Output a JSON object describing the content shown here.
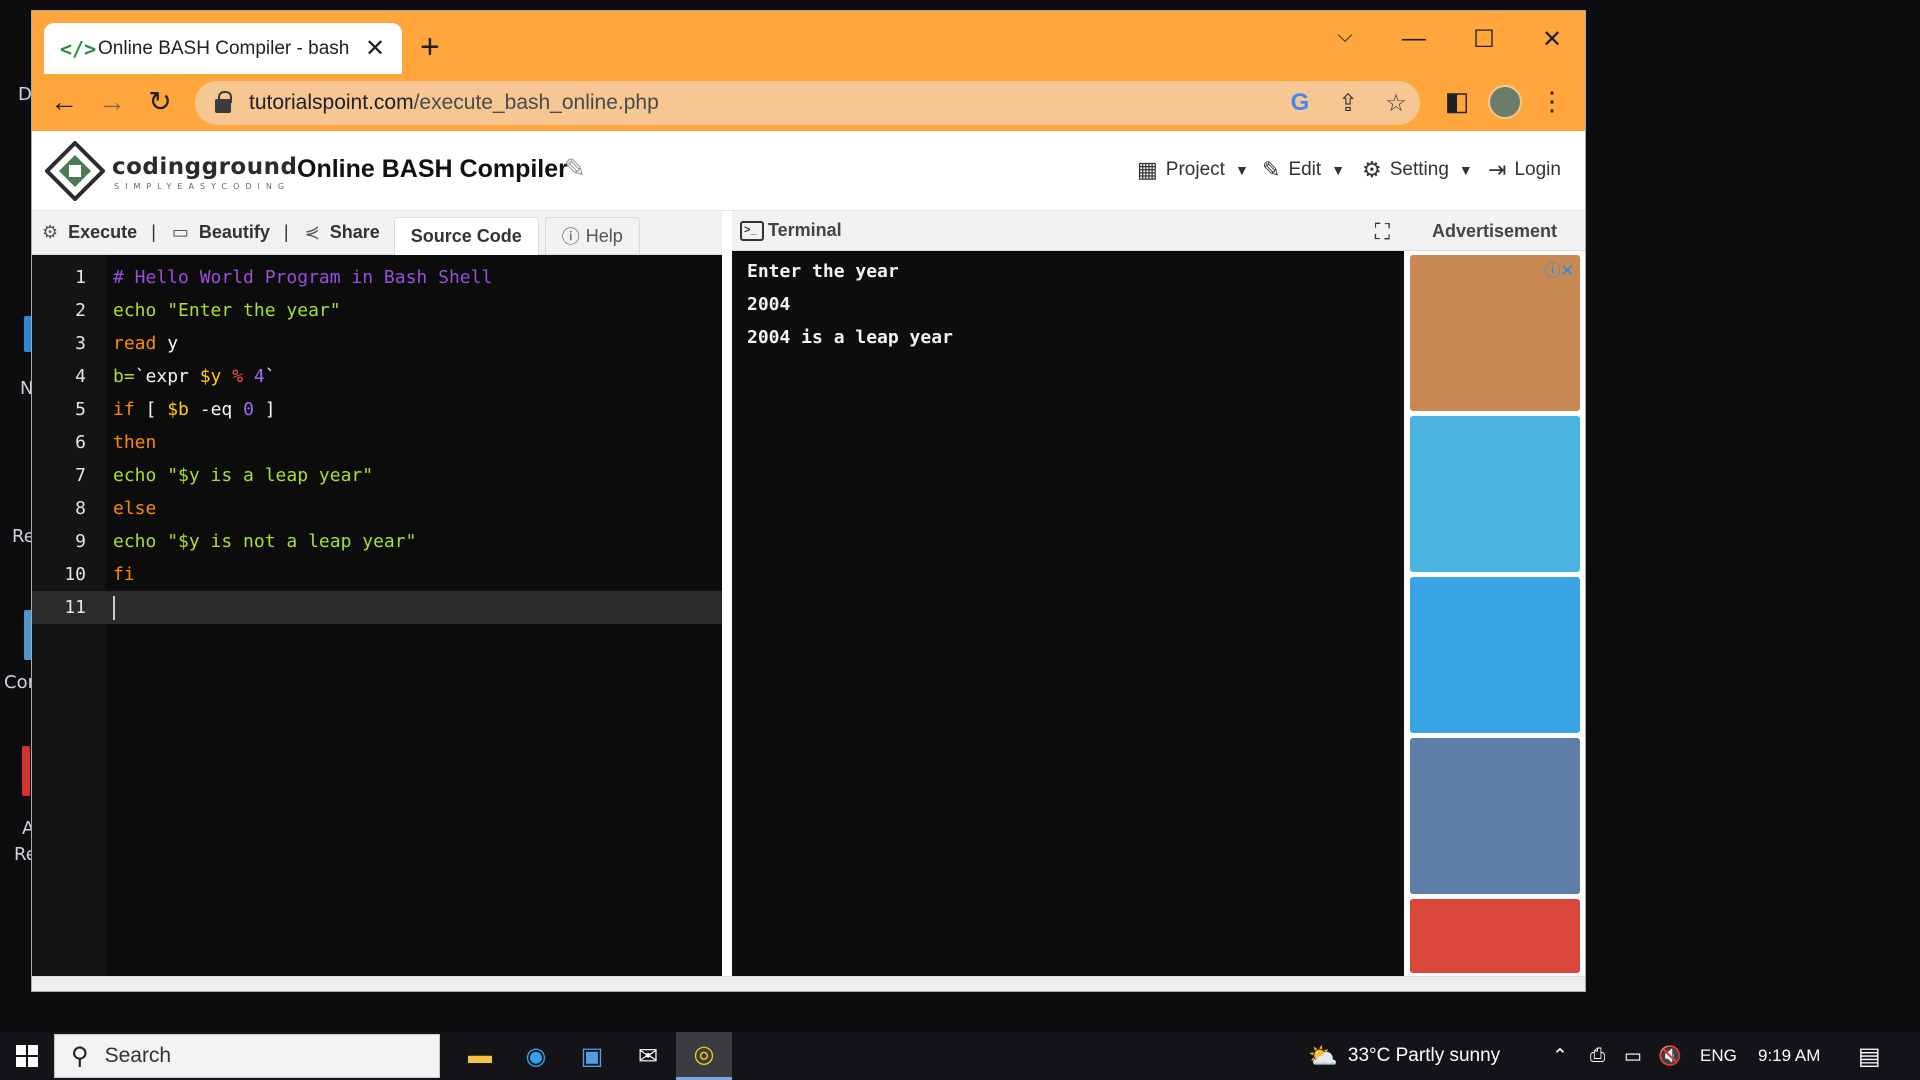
{
  "browser": {
    "tab_title": "Online BASH Compiler - bash",
    "tab_favicon": "</>",
    "url_host": "tutorialspoint.com",
    "url_path": "/execute_bash_online.php"
  },
  "site": {
    "logo_text": "codingground",
    "logo_subtext": "SIMPLYEASYCODING",
    "title": "Online BASH Compiler",
    "menu": {
      "project": "Project",
      "edit": "Edit",
      "setting": "Setting",
      "login": "Login"
    }
  },
  "editor_toolbar": {
    "execute": "Execute",
    "beautify": "Beautify",
    "share": "Share",
    "source_code": "Source Code",
    "help": "Help",
    "separator": "|"
  },
  "code_lines": [
    {
      "num": "1",
      "tokens": [
        {
          "t": "# Hello World Program in Bash Shell",
          "c": "c-comment"
        }
      ]
    },
    {
      "num": "2",
      "tokens": [
        {
          "t": "echo ",
          "c": "c-str"
        },
        {
          "t": "\"Enter the year\"",
          "c": "c-str"
        }
      ]
    },
    {
      "num": "3",
      "tokens": [
        {
          "t": "read",
          "c": "c-kw"
        },
        {
          "t": " y",
          "c": "c-plain"
        }
      ]
    },
    {
      "num": "4",
      "tokens": [
        {
          "t": "b=",
          "c": "c-str"
        },
        {
          "t": "`",
          "c": "c-plain"
        },
        {
          "t": "expr ",
          "c": "c-plain"
        },
        {
          "t": "$y",
          "c": "c-var"
        },
        {
          "t": " % ",
          "c": "c-op"
        },
        {
          "t": "4",
          "c": "c-num"
        },
        {
          "t": "`",
          "c": "c-plain"
        }
      ]
    },
    {
      "num": "5",
      "tokens": [
        {
          "t": "if",
          "c": "c-kw"
        },
        {
          "t": " [ ",
          "c": "c-plain"
        },
        {
          "t": "$b",
          "c": "c-var"
        },
        {
          "t": " -eq ",
          "c": "c-plain"
        },
        {
          "t": "0",
          "c": "c-num"
        },
        {
          "t": " ]",
          "c": "c-plain"
        }
      ]
    },
    {
      "num": "6",
      "tokens": [
        {
          "t": "then",
          "c": "c-kw"
        }
      ]
    },
    {
      "num": "7",
      "tokens": [
        {
          "t": "echo ",
          "c": "c-str"
        },
        {
          "t": "\"$y is a leap year\"",
          "c": "c-str"
        }
      ]
    },
    {
      "num": "8",
      "tokens": [
        {
          "t": "else",
          "c": "c-kw"
        }
      ]
    },
    {
      "num": "9",
      "tokens": [
        {
          "t": "echo ",
          "c": "c-str"
        },
        {
          "t": "\"$y is not a leap year\"",
          "c": "c-str"
        }
      ]
    },
    {
      "num": "10",
      "tokens": [
        {
          "t": "fi",
          "c": "c-kw"
        }
      ]
    },
    {
      "num": "11",
      "tokens": []
    }
  ],
  "terminal": {
    "title": "Terminal",
    "lines": [
      "Enter the year",
      "2004",
      "2004 is a leap year"
    ]
  },
  "ads": {
    "title": "Advertisement",
    "items": [
      {
        "name": "ad-bike-game",
        "bg": "#c88a52"
      },
      {
        "name": "ad-hill-climb",
        "bg": "#4bb3e0"
      },
      {
        "name": "ad-hammer-man",
        "bg": "#3aa5e6"
      },
      {
        "name": "ad-racing",
        "bg": "#5f7fa8"
      },
      {
        "name": "ad-fruit",
        "bg": "#d8473a"
      }
    ]
  },
  "desktop_labels": [
    "D",
    "N",
    "Re",
    "Cor",
    "A",
    "Re"
  ],
  "taskbar": {
    "search_placeholder": "Search",
    "weather": "33°C  Partly sunny",
    "language": "ENG",
    "time": "9:19 AM"
  }
}
